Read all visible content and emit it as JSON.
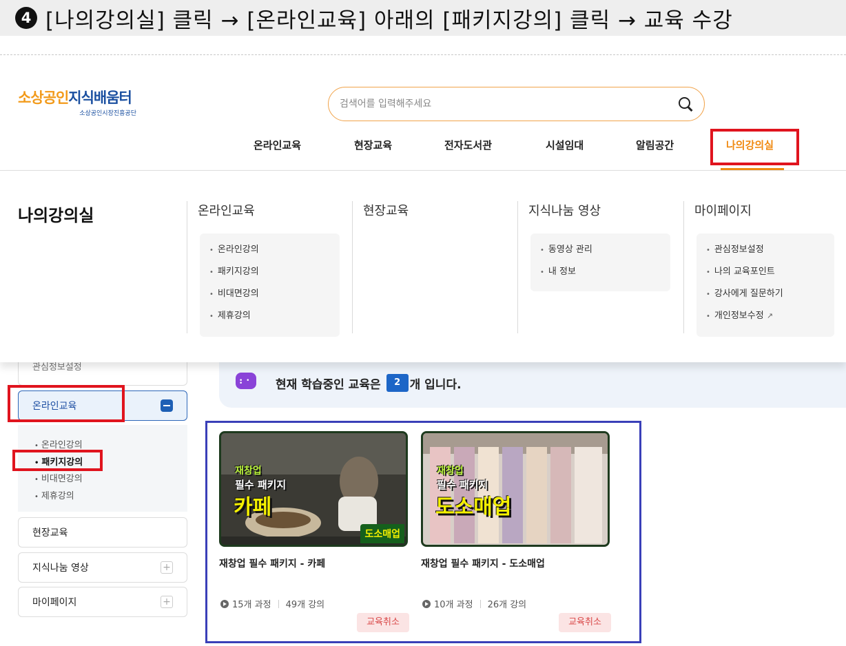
{
  "banner": {
    "step": "4",
    "text": "[나의강의실] 클릭 → [온라인교육] 아래의 [패키지강의] 클릭 → 교육 수강"
  },
  "header": {
    "logo_main_orange": "소상공인",
    "logo_main_blue": "지식배움터",
    "logo_sub": "소상공인시장진흥공단",
    "search_placeholder": "검색어를 입력해주세요"
  },
  "gnb": {
    "items": [
      "온라인교육",
      "현장교육",
      "전자도서관",
      "시설임대",
      "알림공간",
      "나의강의실"
    ],
    "active": "나의강의실",
    "accent": "#f08a12"
  },
  "mega_menu": {
    "title": "나의강의실",
    "columns": [
      {
        "heading": "온라인교육",
        "items": [
          "온라인강의",
          "패키지강의",
          "비대면강의",
          "제휴강의"
        ]
      },
      {
        "heading": "현장교육",
        "items": []
      },
      {
        "heading": "지식나눔 영상",
        "items": [
          "동영상 관리",
          "내 정보"
        ]
      },
      {
        "heading": "마이페이지",
        "items": [
          "관심정보설정",
          "나의 교육포인트",
          "강사에게 질문하기",
          "개인정보수정"
        ]
      }
    ]
  },
  "sidebar": {
    "partial_top": "관심정보설정",
    "online": "온라인교육",
    "online_sub": [
      "온라인강의",
      "패키지강의",
      "비대면강의",
      "제휴강의"
    ],
    "field": "현장교육",
    "video": "지식나눔 영상",
    "mypage": "마이페이지",
    "plus": "+"
  },
  "status": {
    "prefix": "현재 학습중인 교육은",
    "count": "2",
    "suffix": "개 입니다."
  },
  "courses": [
    {
      "thumb_line1": "재창업",
      "thumb_line2": "필수 패키지",
      "thumb_line3": "카페",
      "thumb_corner": "도소매업",
      "title": "재창업 필수 패키지 - 카페",
      "courses_count": "15개 과정",
      "lectures_count": "49개 강의",
      "cancel": "교육취소"
    },
    {
      "thumb_line1": "재창업",
      "thumb_line2": "필수 패키지",
      "thumb_line3": "도소매업",
      "thumb_corner": "",
      "title": "재창업 필수 패키지 - 도소매업",
      "courses_count": "10개 과정",
      "lectures_count": "26개 강의",
      "cancel": "교육취소"
    }
  ],
  "colors": {
    "highlight_red": "#e0141e",
    "highlight_blue": "#3a3fb8",
    "brand_orange": "#f29a1a",
    "brand_blue": "#1a4fa0"
  }
}
